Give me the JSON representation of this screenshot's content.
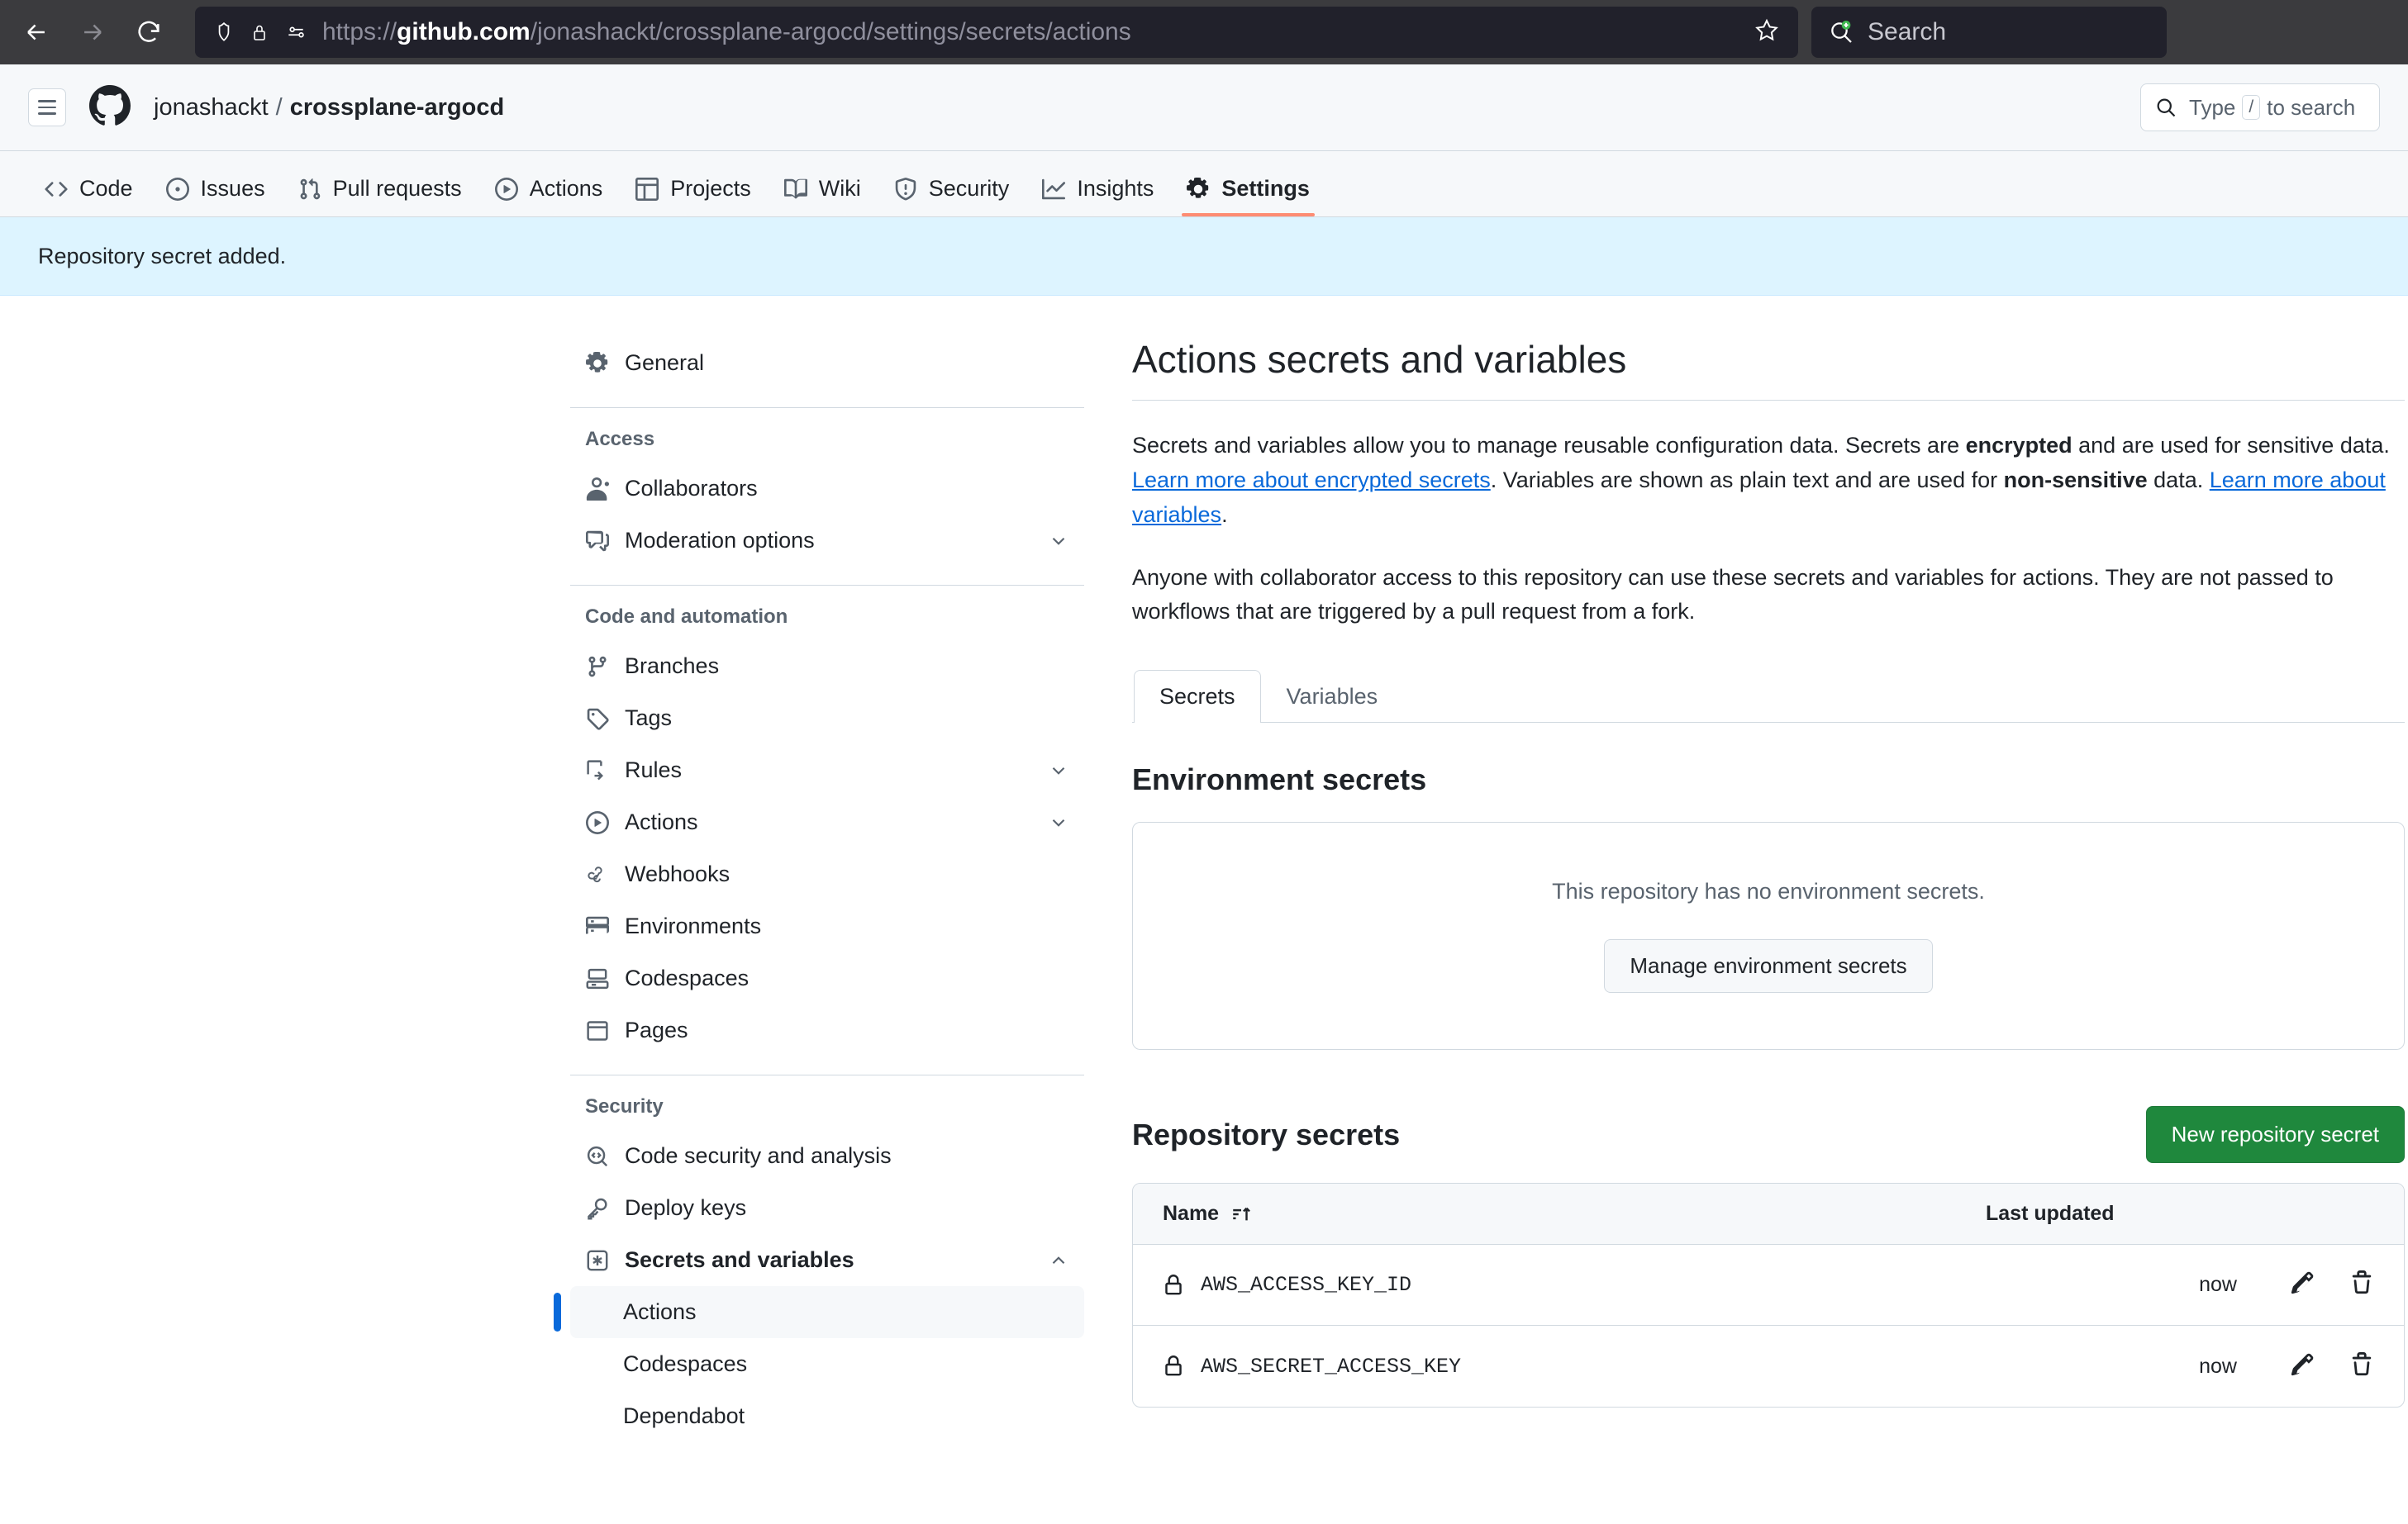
{
  "browser": {
    "back_icon": "back-arrow-icon",
    "forward_icon": "forward-arrow-icon",
    "reload_icon": "reload-icon",
    "url_prefix": "https://",
    "url_host": "github.com",
    "url_path": "/jonashackt/crossplane-argocd/settings/secrets/actions",
    "bookmark_icon": "star-icon",
    "search_placeholder": "Search"
  },
  "gh_header": {
    "menu_icon": "hamburger-icon",
    "logo_icon": "github-logo-icon",
    "owner": "jonashackt",
    "separator": "/",
    "repo": "crossplane-argocd",
    "search_prefix": "Type",
    "search_key": "/",
    "search_suffix": "to search"
  },
  "repo_nav": {
    "tabs": [
      {
        "label": "Code",
        "icon": "code-icon",
        "active": false
      },
      {
        "label": "Issues",
        "icon": "issue-opened-icon",
        "active": false
      },
      {
        "label": "Pull requests",
        "icon": "git-pull-request-icon",
        "active": false
      },
      {
        "label": "Actions",
        "icon": "play-icon",
        "active": false
      },
      {
        "label": "Projects",
        "icon": "table-icon",
        "active": false
      },
      {
        "label": "Wiki",
        "icon": "book-icon",
        "active": false
      },
      {
        "label": "Security",
        "icon": "shield-icon",
        "active": false
      },
      {
        "label": "Insights",
        "icon": "graph-icon",
        "active": false
      },
      {
        "label": "Settings",
        "icon": "gear-icon",
        "active": true
      }
    ]
  },
  "flash": {
    "message": "Repository secret added."
  },
  "sidebar": {
    "general": {
      "label": "General",
      "icon": "gear-icon"
    },
    "groups": [
      {
        "title": "Access",
        "items": [
          {
            "label": "Collaborators",
            "icon": "people-icon",
            "caret": false
          },
          {
            "label": "Moderation options",
            "icon": "comment-discussion-icon",
            "caret": "down"
          }
        ]
      },
      {
        "title": "Code and automation",
        "items": [
          {
            "label": "Branches",
            "icon": "git-branch-icon",
            "caret": false
          },
          {
            "label": "Tags",
            "icon": "tag-icon",
            "caret": false
          },
          {
            "label": "Rules",
            "icon": "rules-icon",
            "caret": "down"
          },
          {
            "label": "Actions",
            "icon": "play-icon",
            "caret": "down"
          },
          {
            "label": "Webhooks",
            "icon": "webhook-icon",
            "caret": false
          },
          {
            "label": "Environments",
            "icon": "server-icon",
            "caret": false
          },
          {
            "label": "Codespaces",
            "icon": "codespaces-icon",
            "caret": false
          },
          {
            "label": "Pages",
            "icon": "browser-icon",
            "caret": false
          }
        ]
      },
      {
        "title": "Security",
        "items": [
          {
            "label": "Code security and analysis",
            "icon": "codescan-icon",
            "caret": false
          },
          {
            "label": "Deploy keys",
            "icon": "key-icon",
            "caret": false
          },
          {
            "label": "Secrets and variables",
            "icon": "asterisk-box-icon",
            "caret": "up",
            "bold": true
          }
        ],
        "subitems": [
          {
            "label": "Actions",
            "selected": true
          },
          {
            "label": "Codespaces",
            "selected": false
          },
          {
            "label": "Dependabot",
            "selected": false
          }
        ]
      }
    ]
  },
  "main": {
    "title": "Actions secrets and variables",
    "intro": {
      "p1_a": "Secrets and variables allow you to manage reusable configuration data. Secrets are ",
      "p1_b": "encrypted",
      "p1_c": " and are used for sensitive data. ",
      "p1_link1": "Learn more about encrypted secrets",
      "p1_d": ". Variables are shown as plain text and are used for ",
      "p1_e": "non-sensitive",
      "p1_f": " data. ",
      "p1_link2": "Learn more about variables",
      "p1_g": ".",
      "p2": "Anyone with collaborator access to this repository can use these secrets and variables for actions. They are not passed to workflows that are triggered by a pull request from a fork."
    },
    "tabs": [
      {
        "label": "Secrets",
        "active": true
      },
      {
        "label": "Variables",
        "active": false
      }
    ],
    "environment_secrets": {
      "title": "Environment secrets",
      "empty_message": "This repository has no environment secrets.",
      "manage_button": "Manage environment secrets"
    },
    "repository_secrets": {
      "title": "Repository secrets",
      "new_button": "New repository secret",
      "columns": {
        "name": "Name",
        "sort_icon": "sort-asc-icon",
        "last_updated": "Last updated"
      },
      "rows": [
        {
          "icon": "lock-icon",
          "name": "AWS_ACCESS_KEY_ID",
          "last_updated": "now",
          "edit_icon": "pencil-icon",
          "delete_icon": "trash-icon"
        },
        {
          "icon": "lock-icon",
          "name": "AWS_SECRET_ACCESS_KEY",
          "last_updated": "now",
          "edit_icon": "pencil-icon",
          "delete_icon": "trash-icon"
        }
      ]
    }
  },
  "colors": {
    "accent_blue": "#0969da",
    "active_tab_underline": "#fd8c73",
    "primary_green": "#1f883d",
    "flash_bg": "#ddf4ff"
  }
}
